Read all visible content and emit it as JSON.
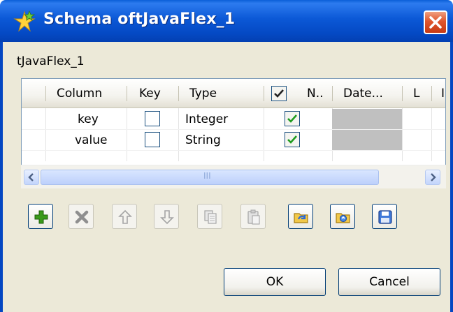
{
  "window": {
    "title": "Schema oftJavaFlex_1",
    "title_icon": "talend-star-icon",
    "close_icon": "close-icon"
  },
  "component_label": "tJavaFlex_1",
  "table": {
    "headers": {
      "column": "Column",
      "key": "Key",
      "type": "Type",
      "nullable": "N..",
      "date": "Date...",
      "length": "L",
      "precision": "I"
    },
    "header_checkbox_checked": true,
    "rows": [
      {
        "column": "key",
        "key": false,
        "type": "Integer",
        "nullable": true
      },
      {
        "column": "value",
        "key": false,
        "type": "String",
        "nullable": true
      }
    ]
  },
  "scrollbar": {
    "left_icon": "arrow-left-icon",
    "right_icon": "arrow-right-icon",
    "grip": "III"
  },
  "toolbar": [
    {
      "name": "add-icon",
      "enabled": true
    },
    {
      "name": "delete-icon",
      "enabled": false
    },
    {
      "name": "move-up-icon",
      "enabled": false
    },
    {
      "name": "move-down-icon",
      "enabled": false
    },
    {
      "name": "copy-icon",
      "enabled": false
    },
    {
      "name": "paste-icon",
      "enabled": false
    },
    {
      "name": "import-icon",
      "enabled": true
    },
    {
      "name": "export-icon",
      "enabled": true
    },
    {
      "name": "save-icon",
      "enabled": true
    }
  ],
  "buttons": {
    "ok": "OK",
    "cancel": "Cancel"
  },
  "colors": {
    "titlebar": "#0449c4",
    "window_bg": "#ece9d8",
    "grey_cell": "#c0c0c0",
    "check_green": "#1e9b1e",
    "add_green": "#3a9a1a"
  }
}
